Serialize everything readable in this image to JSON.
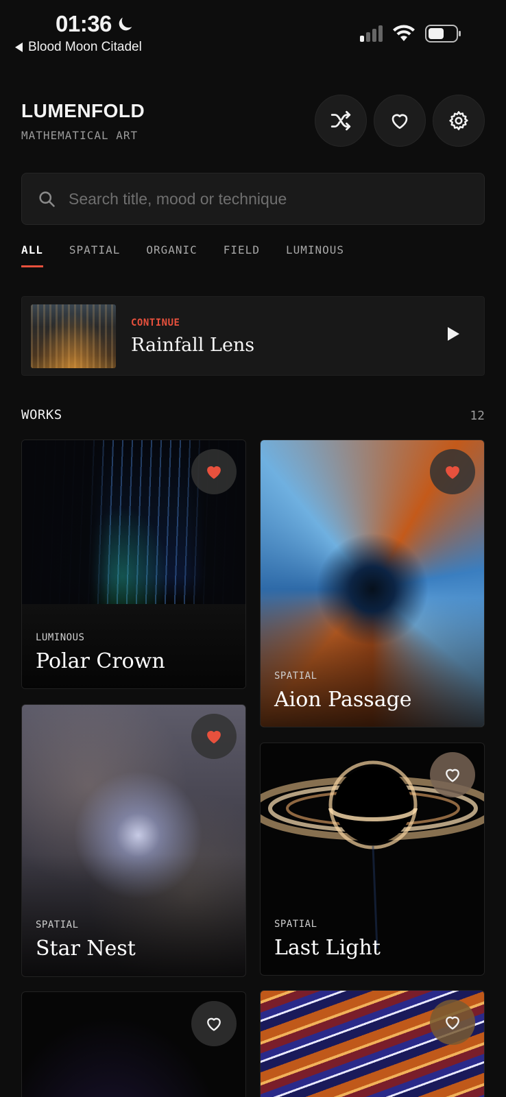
{
  "status_bar": {
    "time": "01:36",
    "back_app": "Blood Moon Citadel"
  },
  "header": {
    "title": "LUMENFOLD",
    "subtitle": "MATHEMATICAL ART"
  },
  "search": {
    "placeholder": "Search title, mood or technique"
  },
  "tabs": [
    "ALL",
    "SPATIAL",
    "ORGANIC",
    "FIELD",
    "LUMINOUS"
  ],
  "active_tab": "ALL",
  "continue_card": {
    "label": "CONTINUE",
    "title": "Rainfall Lens"
  },
  "works": {
    "heading": "WORKS",
    "count": "12",
    "items": [
      {
        "category": "LUMINOUS",
        "title": "Polar Crown",
        "favorited": true
      },
      {
        "category": "SPATIAL",
        "title": "Aion Passage",
        "favorited": true
      },
      {
        "category": "SPATIAL",
        "title": "Star Nest",
        "favorited": true
      },
      {
        "category": "SPATIAL",
        "title": "Last Light",
        "favorited": false
      },
      {
        "category": "",
        "title": "",
        "favorited": false
      },
      {
        "category": "",
        "title": "",
        "favorited": false
      }
    ]
  },
  "colors": {
    "accent": "#e8513d",
    "background": "#0d0d0d",
    "surface": "#1a1a1a"
  },
  "icons": {
    "status_moon": "moon-icon",
    "shuffle": "shuffle-icon",
    "favorites": "heart-icon",
    "settings": "gear-icon",
    "search": "search-icon",
    "play": "play-icon"
  }
}
